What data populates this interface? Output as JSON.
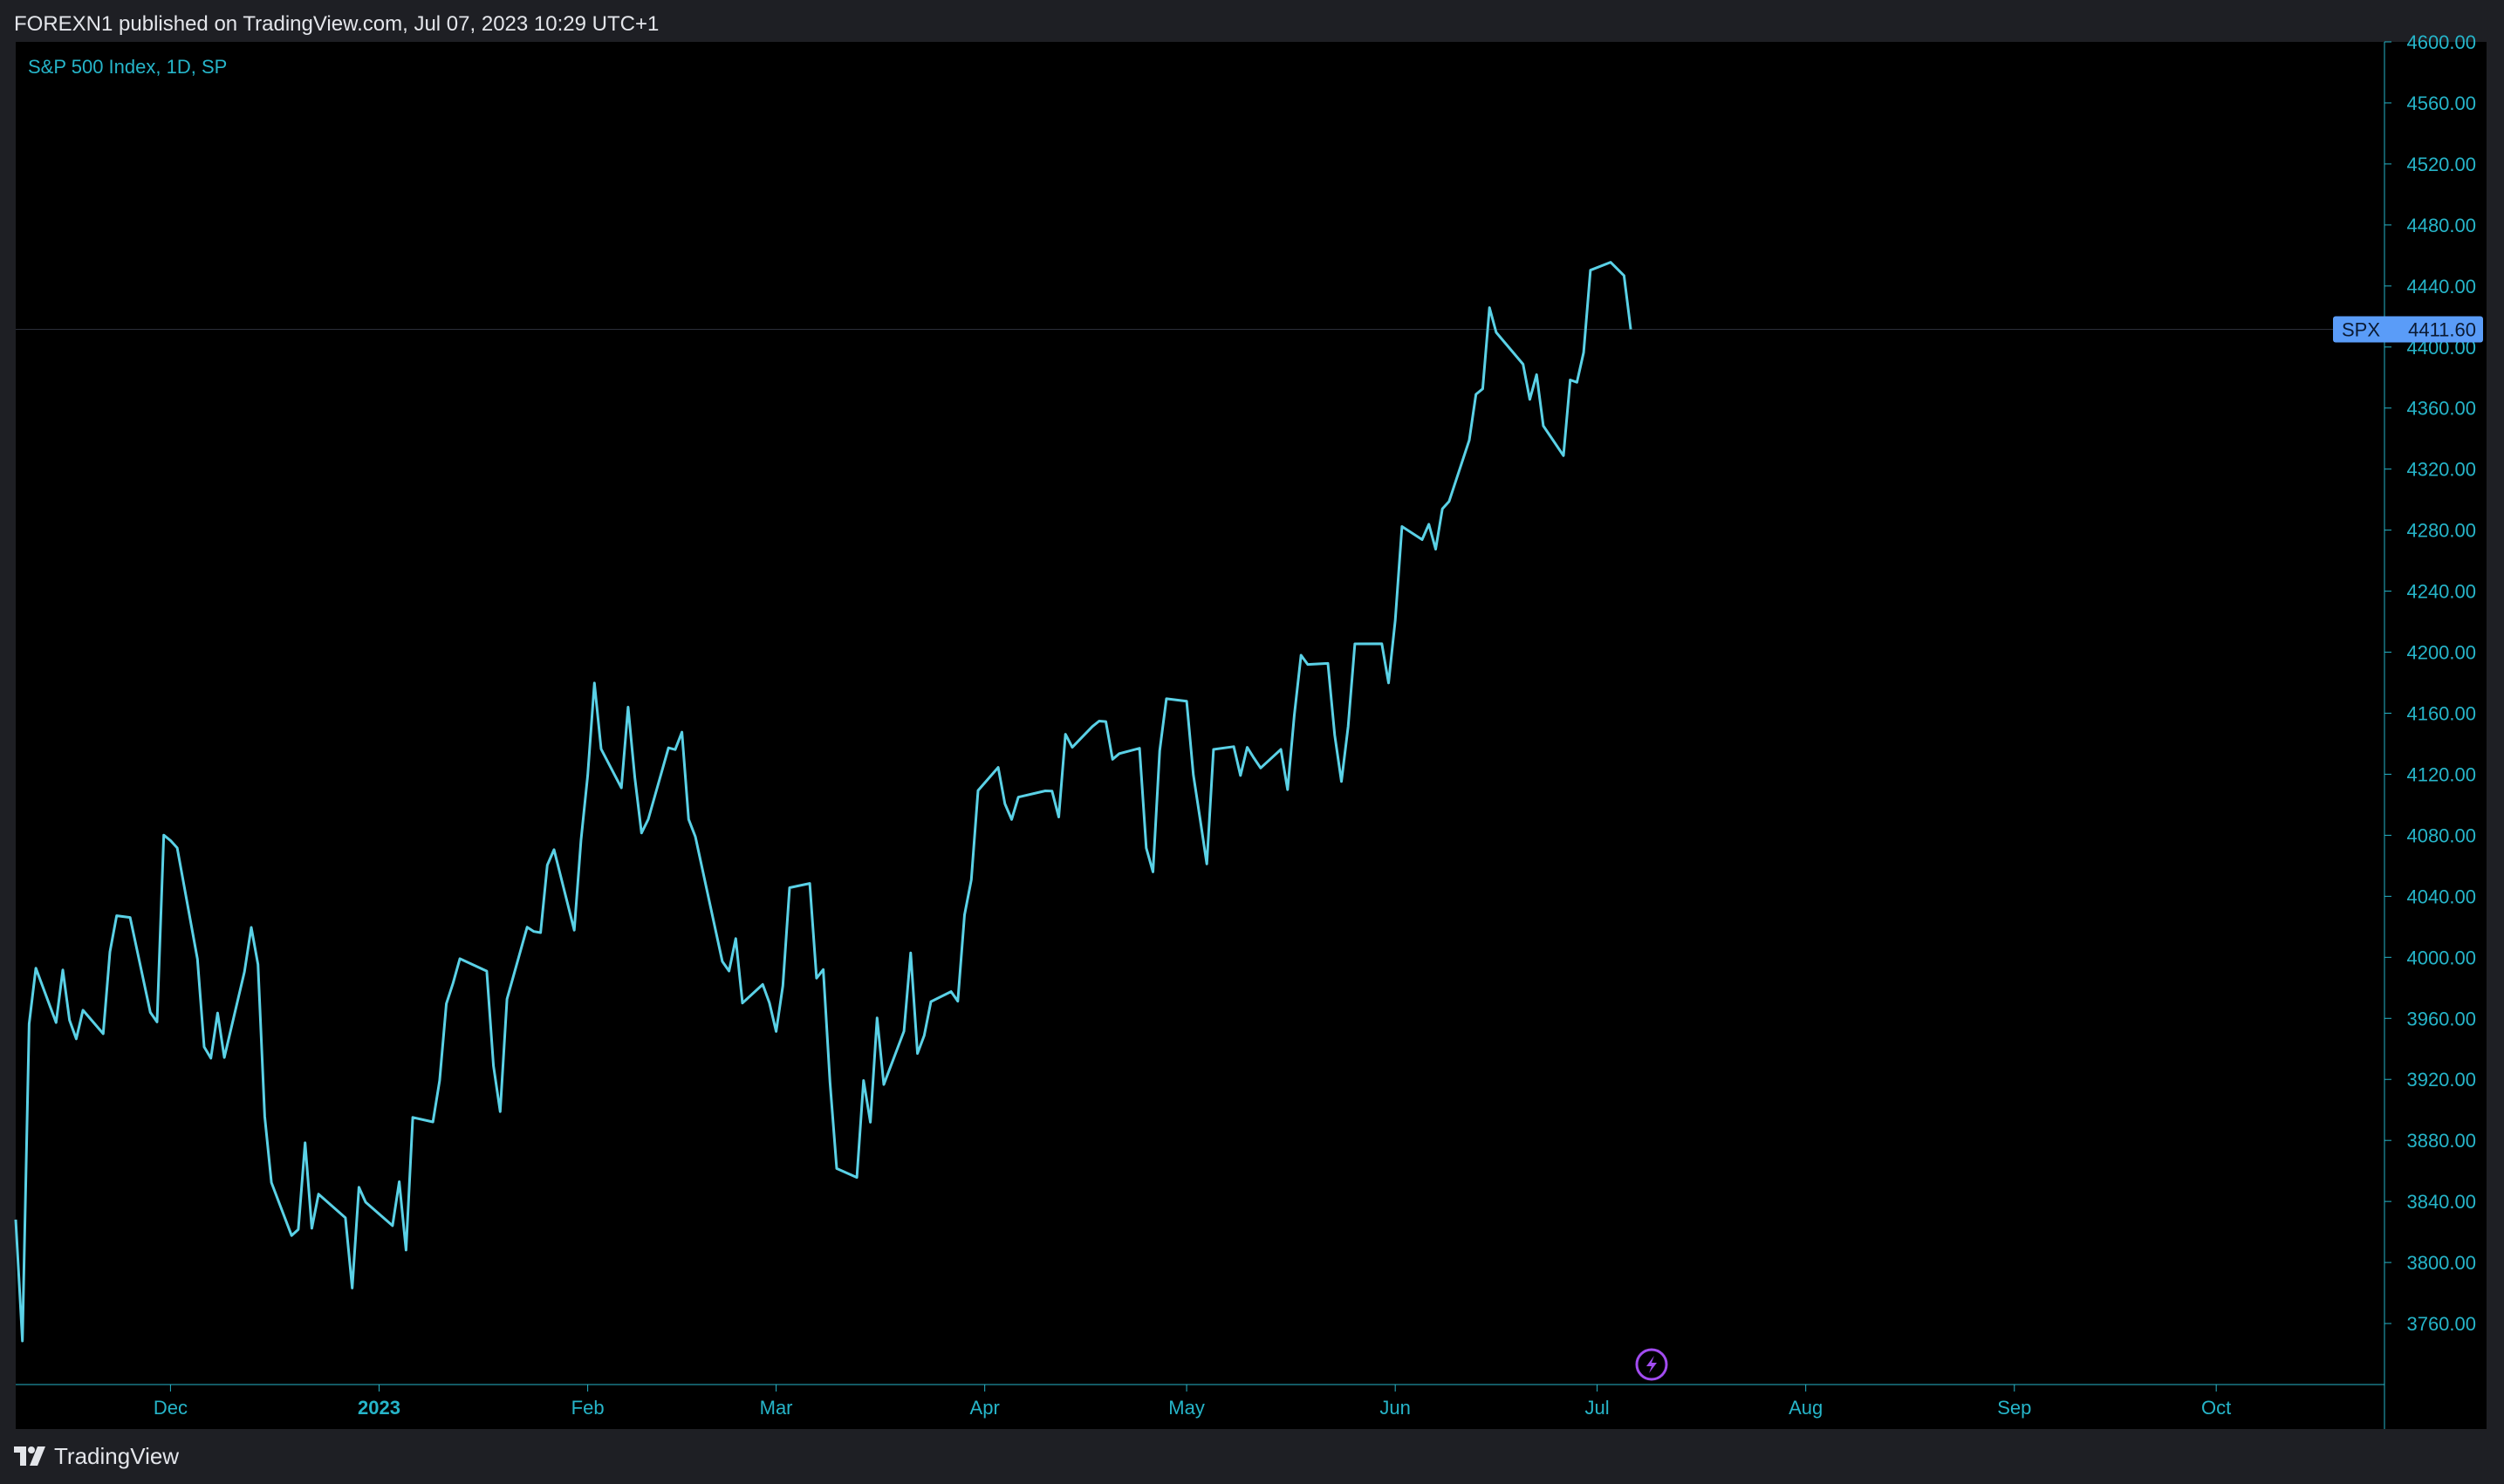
{
  "header": {
    "published_text": "FOREXN1 published on TradingView.com, Jul 07, 2023 10:29 UTC+1"
  },
  "footer": {
    "brand": "TradingView",
    "logo_icon": "tradingview-logo-icon"
  },
  "colors": {
    "page_bg": "#1e1f24",
    "plot_bg": "#000000",
    "line": "#5ad1e6",
    "axis_text": "#26b5c9",
    "price_label_bg": "#5a9cf8",
    "lightning_icon": "#a24cf0"
  },
  "chart_data": {
    "type": "line",
    "title": "S&P 500 Index, 1D, SP",
    "xlabel": "",
    "ylabel": "",
    "ylim": [
      3720,
      4600
    ],
    "y_ticks": [
      "3760.00",
      "3800.00",
      "3840.00",
      "3880.00",
      "3920.00",
      "3960.00",
      "4000.00",
      "4040.00",
      "4080.00",
      "4120.00",
      "4160.00",
      "4200.00",
      "4240.00",
      "4280.00",
      "4320.00",
      "4360.00",
      "4400.00",
      "4440.00",
      "4480.00",
      "4520.00",
      "4560.00",
      "4600.00"
    ],
    "x_range": [
      "2022-11-08",
      "2023-10-26"
    ],
    "x_ticks": [
      {
        "date": "2022-12-01",
        "label": "Dec",
        "bold": false
      },
      {
        "date": "2023-01-01",
        "label": "2023",
        "bold": true
      },
      {
        "date": "2023-02-01",
        "label": "Feb",
        "bold": false
      },
      {
        "date": "2023-03-01",
        "label": "Mar",
        "bold": false
      },
      {
        "date": "2023-04-01",
        "label": "Apr",
        "bold": false
      },
      {
        "date": "2023-05-01",
        "label": "May",
        "bold": false
      },
      {
        "date": "2023-06-01",
        "label": "Jun",
        "bold": false
      },
      {
        "date": "2023-07-01",
        "label": "Jul",
        "bold": false
      },
      {
        "date": "2023-08-01",
        "label": "Aug",
        "bold": false
      },
      {
        "date": "2023-09-01",
        "label": "Sep",
        "bold": false
      },
      {
        "date": "2023-10-01",
        "label": "Oct",
        "bold": false
      }
    ],
    "last_price": {
      "symbol": "SPX",
      "value": "4411.60"
    },
    "series": [
      {
        "x": [
          "2022-11-08",
          "2022-11-09",
          "2022-11-10",
          "2022-11-11",
          "2022-11-14",
          "2022-11-15",
          "2022-11-16",
          "2022-11-17",
          "2022-11-18",
          "2022-11-21",
          "2022-11-22",
          "2022-11-23",
          "2022-11-25",
          "2022-11-28",
          "2022-11-29",
          "2022-11-30",
          "2022-12-01",
          "2022-12-02",
          "2022-12-05",
          "2022-12-06",
          "2022-12-07",
          "2022-12-08",
          "2022-12-09",
          "2022-12-12",
          "2022-12-13",
          "2022-12-14",
          "2022-12-15",
          "2022-12-16",
          "2022-12-19",
          "2022-12-20",
          "2022-12-21",
          "2022-12-22",
          "2022-12-23",
          "2022-12-27",
          "2022-12-28",
          "2022-12-29",
          "2022-12-30",
          "2023-01-03",
          "2023-01-04",
          "2023-01-05",
          "2023-01-06",
          "2023-01-09",
          "2023-01-10",
          "2023-01-11",
          "2023-01-12",
          "2023-01-13",
          "2023-01-17",
          "2023-01-18",
          "2023-01-19",
          "2023-01-20",
          "2023-01-23",
          "2023-01-24",
          "2023-01-25",
          "2023-01-26",
          "2023-01-27",
          "2023-01-30",
          "2023-01-31",
          "2023-02-01",
          "2023-02-02",
          "2023-02-03",
          "2023-02-06",
          "2023-02-07",
          "2023-02-08",
          "2023-02-09",
          "2023-02-10",
          "2023-02-13",
          "2023-02-14",
          "2023-02-15",
          "2023-02-16",
          "2023-02-17",
          "2023-02-21",
          "2023-02-22",
          "2023-02-23",
          "2023-02-24",
          "2023-02-27",
          "2023-02-28",
          "2023-03-01",
          "2023-03-02",
          "2023-03-03",
          "2023-03-06",
          "2023-03-07",
          "2023-03-08",
          "2023-03-09",
          "2023-03-10",
          "2023-03-13",
          "2023-03-14",
          "2023-03-15",
          "2023-03-16",
          "2023-03-17",
          "2023-03-20",
          "2023-03-21",
          "2023-03-22",
          "2023-03-23",
          "2023-03-24",
          "2023-03-27",
          "2023-03-28",
          "2023-03-29",
          "2023-03-30",
          "2023-03-31",
          "2023-04-03",
          "2023-04-04",
          "2023-04-05",
          "2023-04-06",
          "2023-04-10",
          "2023-04-11",
          "2023-04-12",
          "2023-04-13",
          "2023-04-14",
          "2023-04-17",
          "2023-04-18",
          "2023-04-19",
          "2023-04-20",
          "2023-04-21",
          "2023-04-24",
          "2023-04-25",
          "2023-04-26",
          "2023-04-27",
          "2023-04-28",
          "2023-05-01",
          "2023-05-02",
          "2023-05-03",
          "2023-05-04",
          "2023-05-05",
          "2023-05-08",
          "2023-05-09",
          "2023-05-10",
          "2023-05-11",
          "2023-05-12",
          "2023-05-15",
          "2023-05-16",
          "2023-05-17",
          "2023-05-18",
          "2023-05-19",
          "2023-05-22",
          "2023-05-23",
          "2023-05-24",
          "2023-05-25",
          "2023-05-26",
          "2023-05-30",
          "2023-05-31",
          "2023-06-01",
          "2023-06-02",
          "2023-06-05",
          "2023-06-06",
          "2023-06-07",
          "2023-06-08",
          "2023-06-09",
          "2023-06-12",
          "2023-06-13",
          "2023-06-14",
          "2023-06-15",
          "2023-06-16",
          "2023-06-20",
          "2023-06-21",
          "2023-06-22",
          "2023-06-23",
          "2023-06-26",
          "2023-06-27",
          "2023-06-28",
          "2023-06-29",
          "2023-06-30",
          "2023-07-03",
          "2023-07-05",
          "2023-07-06"
        ],
        "y": [
          3828.11,
          3748.57,
          3956.37,
          3992.93,
          3957.25,
          3991.73,
          3958.79,
          3946.56,
          3965.34,
          3949.94,
          4003.58,
          4027.26,
          4026.12,
          3963.94,
          3957.63,
          4080.11,
          4076.57,
          4071.7,
          3998.84,
          3941.26,
          3933.92,
          3963.51,
          3934.38,
          3990.56,
          4019.65,
          3995.32,
          3895.75,
          3852.36,
          3817.66,
          3821.62,
          3878.44,
          3822.39,
          3844.82,
          3829.25,
          3783.22,
          3849.28,
          3839.5,
          3824.14,
          3852.97,
          3808.1,
          3895.08,
          3892.09,
          3919.25,
          3969.61,
          3983.17,
          3999.09,
          3990.97,
          3928.86,
          3898.85,
          3972.61,
          4019.81,
          4016.95,
          4016.22,
          4060.43,
          4070.56,
          4017.77,
          4076.6,
          4119.21,
          4179.76,
          4136.48,
          4111.08,
          4164.0,
          4117.86,
          4081.5,
          4090.46,
          4137.29,
          4136.13,
          4147.6,
          4090.41,
          4079.09,
          3997.34,
          3991.05,
          4012.32,
          3970.04,
          3982.24,
          3970.15,
          3951.39,
          3981.35,
          4045.64,
          4048.42,
          3986.37,
          3992.01,
          3918.32,
          3861.59,
          3855.76,
          3919.29,
          3891.93,
          3960.28,
          3916.64,
          3951.57,
          4002.87,
          3936.97,
          3948.72,
          3970.99,
          3977.53,
          3971.27,
          4027.81,
          4050.83,
          4109.31,
          4124.51,
          4100.6,
          4090.38,
          4105.02,
          4109.11,
          4108.94,
          4091.95,
          4146.22,
          4137.64,
          4151.32,
          4154.87,
          4154.52,
          4129.79,
          4133.52,
          4137.04,
          4071.63,
          4055.99,
          4135.35,
          4169.48,
          4167.87,
          4119.58,
          4090.75,
          4061.22,
          4136.25,
          4138.12,
          4119.17,
          4137.64,
          4130.62,
          4124.08,
          4136.28,
          4109.9,
          4158.77,
          4198.05,
          4191.98,
          4192.63,
          4145.58,
          4115.24,
          4151.28,
          4205.45,
          4205.52,
          4179.83,
          4221.02,
          4282.37,
          4273.79,
          4283.85,
          4267.52,
          4293.93,
          4298.86,
          4338.93,
          4369.01,
          4372.59,
          4425.84,
          4409.59,
          4388.71,
          4365.69,
          4381.89,
          4348.33,
          4328.82,
          4378.41,
          4376.86,
          4396.44,
          4450.38,
          4455.59,
          4446.82,
          4411.6
        ]
      }
    ]
  }
}
